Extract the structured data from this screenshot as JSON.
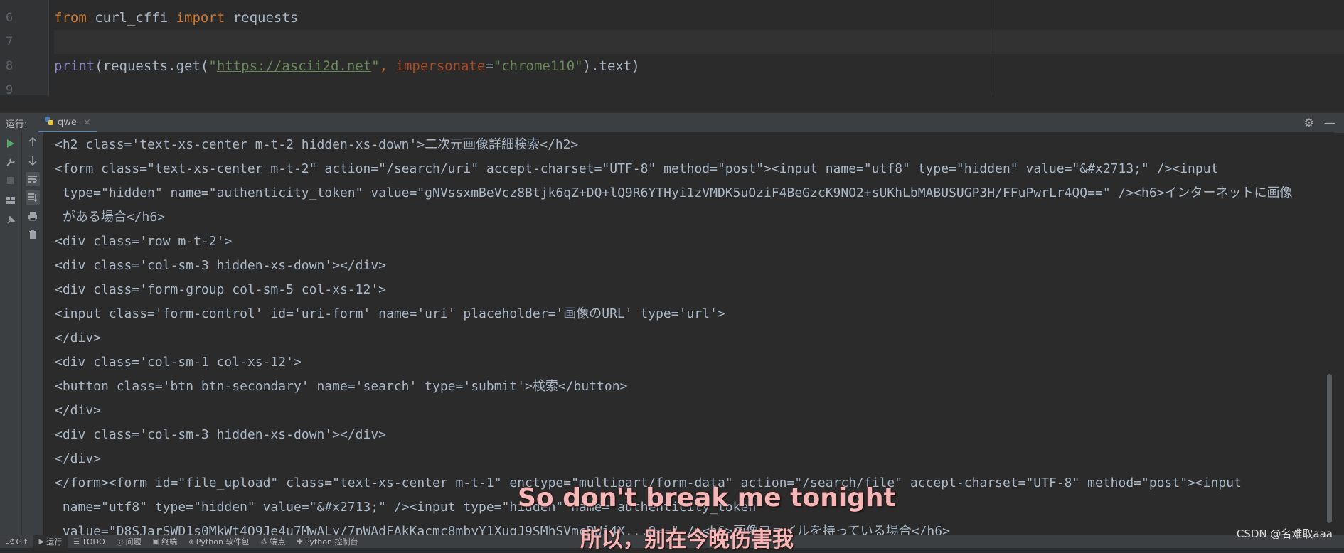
{
  "editor": {
    "line_numbers": [
      "6",
      "7",
      "8",
      "9"
    ],
    "code": {
      "line6": {
        "kw_from": "from",
        "module": " curl_cffi ",
        "kw_import": "import",
        "name": " requests"
      },
      "line8": {
        "fn": "print",
        "open": "(requests.get(",
        "q1": "\"",
        "url": "https://ascii2d.net",
        "q2": "\"",
        "comma": ", ",
        "param": "impersonate",
        "eq": "=",
        "str": "\"chrome110\"",
        "close": ").text)"
      }
    }
  },
  "run": {
    "label": "运行:",
    "tab_name": "qwe",
    "close": "×",
    "gear": "⚙",
    "minimize": "—"
  },
  "console_lines": [
    "<h2 class='text-xs-center m-t-2 hidden-xs-down'>二次元画像詳細検索</h2>",
    "<form class=\"text-xs-center m-t-2\" action=\"/search/uri\" accept-charset=\"UTF-8\" method=\"post\"><input name=\"utf8\" type=\"hidden\" value=\"&#x2713;\" /><input",
    " type=\"hidden\" name=\"authenticity_token\" value=\"gNVssxmBeVcz8Btjk6qZ+DQ+lQ9R6YTHyi1zVMDK5uOziF4BeGzcK9NO2+sUKhLbMABUSUGP3H/FFuPwrLr4QQ==\" /><h6>インターネットに画像",
    " がある場合</h6>",
    "<div class='row m-t-2'>",
    "<div class='col-sm-3 hidden-xs-down'></div>",
    "<div class='form-group col-sm-5 col-xs-12'>",
    "<input class='form-control' id='uri-form' name='uri' placeholder='画像のURL' type='url'>",
    "</div>",
    "<div class='col-sm-1 col-xs-12'>",
    "<button class='btn btn-secondary' name='search' type='submit'>検索</button>",
    "</div>",
    "<div class='col-sm-3 hidden-xs-down'></div>",
    "</div>",
    "</form><form id=\"file_upload\" class=\"text-xs-center m-t-1\" enctype=\"multipart/form-data\" action=\"/search/file\" accept-charset=\"UTF-8\" method=\"post\"><input",
    " name=\"utf8\" type=\"hidden\" value=\"&#x2713;\" /><input type=\"hidden\" name=\"authenticity_token\"",
    " value=\"D8SJarSWD1s0MkWt4O9Je4u7MwALy/7pWAdFAkKacmc8mbyY1XugJ9SMhSVmcDWi4X...Q==\" /><h6>画像ファイルを持っている場合</h6>"
  ],
  "statusbar": [
    {
      "icon": "⎇",
      "label": "Git"
    },
    {
      "icon": "▶",
      "label": "运行"
    },
    {
      "icon": "☰",
      "label": "TODO"
    },
    {
      "icon": "ⓘ",
      "label": "问题"
    },
    {
      "icon": "▣",
      "label": "终端"
    },
    {
      "icon": "◈",
      "label": "Python 软件包"
    },
    {
      "icon": "⁂",
      "label": "端点"
    },
    {
      "icon": "✚",
      "label": "Python 控制台"
    }
  ],
  "overlay": {
    "subtitle_en": "So don't break me tonight",
    "subtitle_zh": "所以，别在今晚伤害我",
    "watermark": "CSDN @名难取aaa"
  },
  "colors": {
    "background": "#2b2b2b",
    "keyword": "#cc7832",
    "string": "#6a8759",
    "param": "#aa4926",
    "builtin": "#8888c6",
    "accent": "#4a88c7"
  }
}
